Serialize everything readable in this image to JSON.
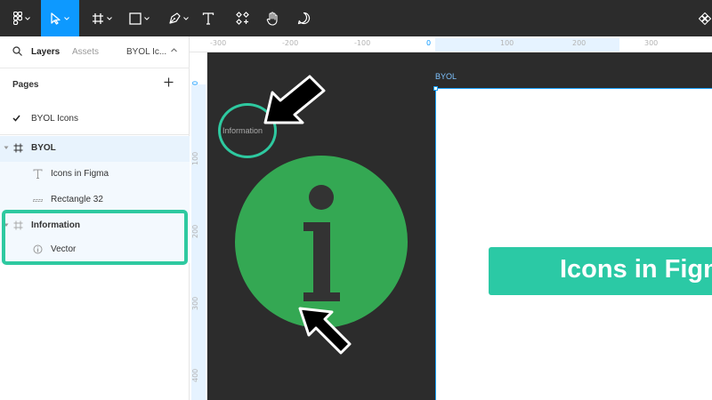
{
  "toolbar": {
    "icons": [
      "figma-menu-icon",
      "move-tool-icon",
      "frame-tool-icon",
      "shape-tool-icon",
      "pen-tool-icon",
      "text-tool-icon",
      "components-icon",
      "hand-tool-icon",
      "comment-icon",
      "component-diamond-icon"
    ],
    "active_tool": "move-tool-icon",
    "active_color": "#0d99ff"
  },
  "panel": {
    "tabs": {
      "layers": "Layers",
      "assets": "Assets",
      "page_select": "BYOL Ic..."
    },
    "pages_label": "Pages",
    "pages": [
      {
        "label": "BYOL Icons",
        "checked": true
      }
    ],
    "layers": [
      {
        "label": "BYOL",
        "icon": "frame-icon"
      },
      {
        "label": "Icons in Figma",
        "icon": "text-layer-icon"
      },
      {
        "label": "Rectangle 32",
        "icon": "rectangle-layer-icon"
      },
      {
        "label": "Information",
        "icon": "frame-icon"
      },
      {
        "label": "Vector",
        "icon": "vector-layer-icon"
      }
    ]
  },
  "rulers": {
    "top": [
      "-300",
      "-200",
      "-100",
      "0",
      "100",
      "200",
      "300"
    ],
    "top_highlight": "0",
    "left": [
      "0",
      "100",
      "200",
      "300",
      "400"
    ],
    "left_highlight": "0"
  },
  "canvas": {
    "frame_name": "BYOL",
    "banner_text": "Icons in Figma",
    "info_label": "Information",
    "colors": {
      "accent": "#2ec9a0",
      "info_green": "#34a853",
      "info_glyph": "#333333",
      "selection": "#18a0fb"
    }
  }
}
